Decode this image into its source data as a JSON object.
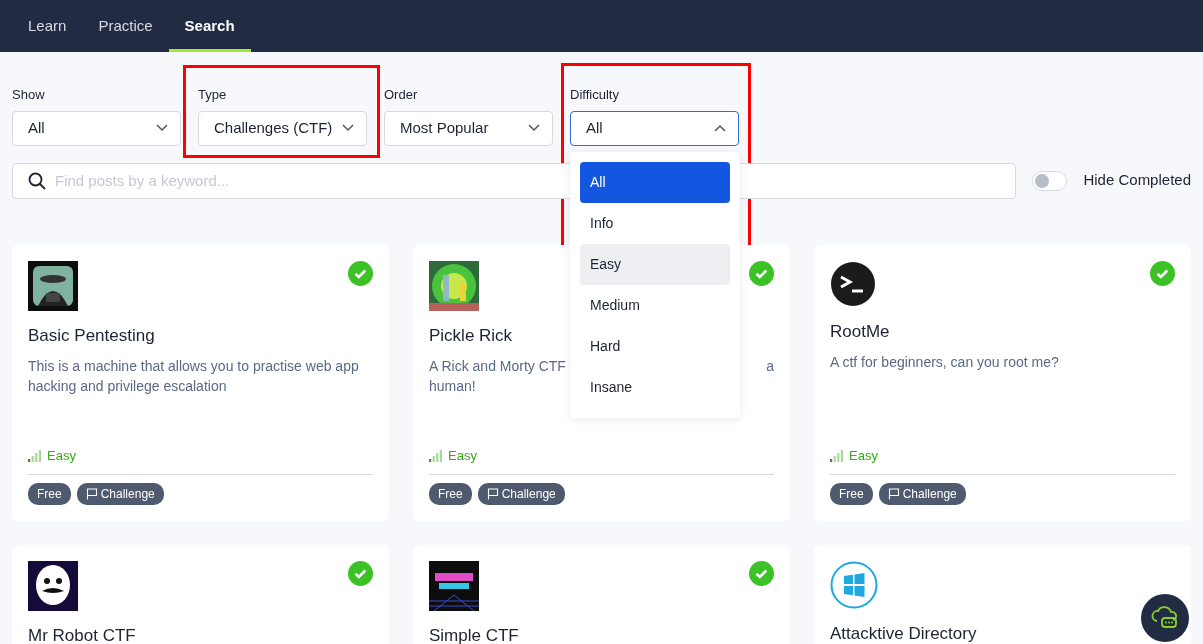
{
  "nav": {
    "tabs": [
      {
        "label": "Learn",
        "selected": false
      },
      {
        "label": "Practice",
        "selected": false
      },
      {
        "label": "Search",
        "selected": true
      }
    ]
  },
  "filters": [
    {
      "label": "Show",
      "value": "All",
      "open": false
    },
    {
      "label": "Type",
      "value": "Challenges (CTF)",
      "open": false,
      "highlighted": true
    },
    {
      "label": "Order",
      "value": "Most Popular",
      "open": false
    },
    {
      "label": "Difficulty",
      "value": "All",
      "open": true,
      "highlighted": true,
      "options": [
        {
          "label": "All",
          "selected": true,
          "hovered": false
        },
        {
          "label": "Info",
          "selected": false,
          "hovered": false
        },
        {
          "label": "Easy",
          "selected": false,
          "hovered": true
        },
        {
          "label": "Medium",
          "selected": false,
          "hovered": false
        },
        {
          "label": "Hard",
          "selected": false,
          "hovered": false
        },
        {
          "label": "Insane",
          "selected": false,
          "hovered": false
        }
      ]
    }
  ],
  "search": {
    "placeholder": "Find posts by a keyword..."
  },
  "hide_completed": {
    "label": "Hide Completed",
    "on": false
  },
  "cards": [
    {
      "title": "Basic Pentesting",
      "description": "This is a machine that allows you to practise web app hacking and privilege escalation",
      "completed": true,
      "kind": "picture",
      "difficulty": {
        "label": "Easy",
        "level": 0.25
      },
      "tags": [
        {
          "label": "Free",
          "kind": "plain"
        },
        {
          "label": "Challenge",
          "kind": "flag"
        }
      ]
    },
    {
      "title": "Pickle Rick",
      "description": [
        "A Rick and Morty CTF",
        "a",
        "human!"
      ],
      "completed": true,
      "kind": "picture",
      "difficulty": {
        "label": "Easy",
        "level": 0.25
      },
      "tags": [
        {
          "label": "Free",
          "kind": "plain"
        },
        {
          "label": "Challenge",
          "kind": "flag"
        }
      ]
    },
    {
      "title": "RootMe",
      "description": "A ctf for beginners, can you root me?",
      "completed": true,
      "kind": "terminal",
      "difficulty": {
        "label": "Easy",
        "level": 0.25
      },
      "tags": [
        {
          "label": "Free",
          "kind": "plain"
        },
        {
          "label": "Challenge",
          "kind": "flag"
        }
      ]
    },
    {
      "title": "Mr Robot CTF",
      "completed": true,
      "kind": "picture"
    },
    {
      "title": "Simple CTF",
      "completed": true,
      "kind": "picture"
    },
    {
      "title": "Attacktive Directory",
      "completed": false,
      "kind": "windows"
    }
  ]
}
